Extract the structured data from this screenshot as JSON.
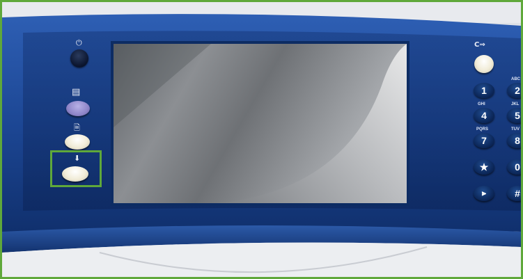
{
  "control_panel": {
    "left_buttons": {
      "power_icon_glyph": "⏻",
      "job_status_icon_glyph": "▤",
      "machine_status_icon_glyph": "🗎",
      "services_home_icon_glyph": "⬇"
    },
    "screen": {
      "state": "blank touchscreen"
    },
    "keypad": {
      "clear_all_glyph": "C⇒",
      "keys": [
        {
          "digit": "1",
          "letters": ""
        },
        {
          "digit": "2",
          "letters": "ABC"
        },
        {
          "digit": "4",
          "letters": "GHI"
        },
        {
          "digit": "5",
          "letters": "JKL"
        },
        {
          "digit": "7",
          "letters": "PQRS"
        },
        {
          "digit": "8",
          "letters": "TUV"
        },
        {
          "digit": "★",
          "letters": ""
        },
        {
          "digit": "0",
          "letters": ""
        },
        {
          "digit": "⫸",
          "letters": ""
        },
        {
          "digit": "#",
          "letters": ""
        }
      ]
    },
    "highlight_color": "#5fa83a",
    "panel_color": "#1c4693"
  }
}
